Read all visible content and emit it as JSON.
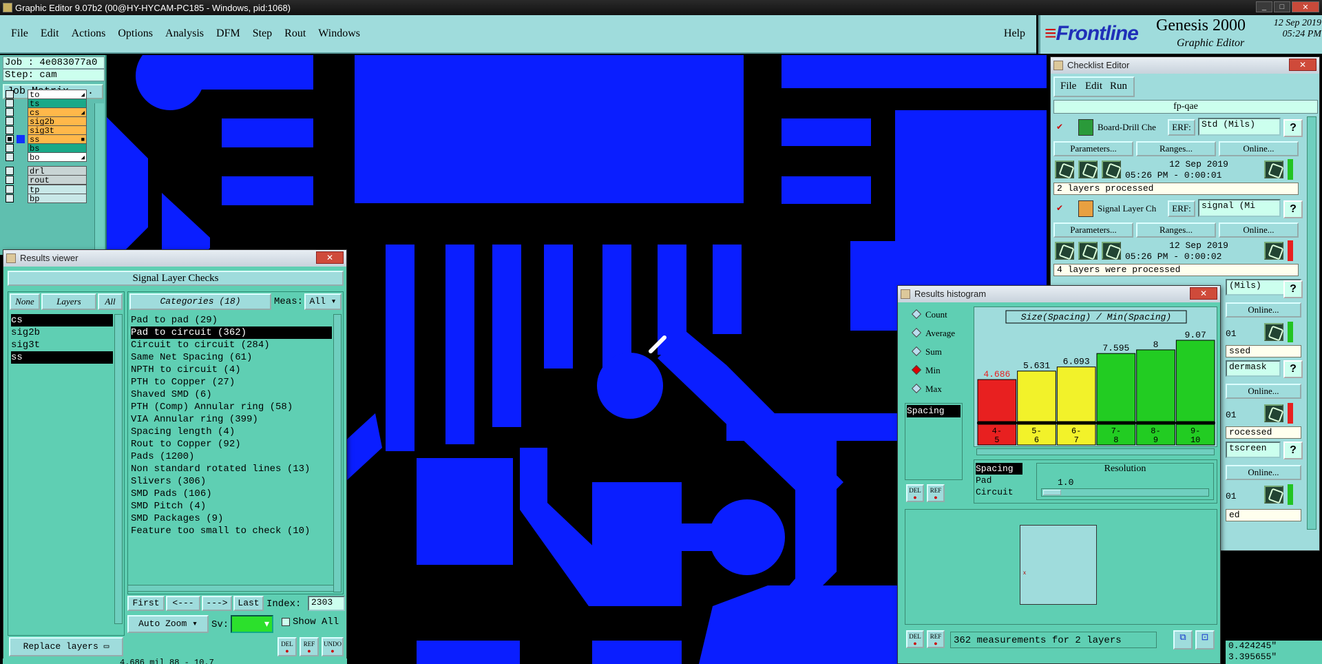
{
  "titlebar": {
    "text": "Graphic Editor 9.07b2 (00@HY-HYCAM-PC185 - Windows, pid:1068)"
  },
  "menu": [
    "File",
    "Edit",
    "Actions",
    "Options",
    "Analysis",
    "DFM",
    "Step",
    "Rout",
    "Windows"
  ],
  "help": "Help",
  "brand": {
    "logo": "Frontline",
    "product": "Genesis 2000",
    "sub": "Graphic Editor",
    "date": "12 Sep 2019",
    "time": "05:24 PM"
  },
  "job": {
    "job": "Job : 4e083077a0",
    "step": "Step: cam",
    "job_matrix": "Job Matrix ..."
  },
  "layers": [
    {
      "name": "to",
      "color": "#ffffff",
      "checked": false,
      "mark": "◢"
    },
    {
      "name": "ts",
      "color": "#1aa988",
      "checked": false,
      "mark": ""
    },
    {
      "name": "cs",
      "color": "#ffb84a",
      "checked": false,
      "mark": "◢"
    },
    {
      "name": "sig2b",
      "color": "#ffb84a",
      "checked": false,
      "mark": ""
    },
    {
      "name": "sig3t",
      "color": "#ffb84a",
      "checked": false,
      "mark": ""
    },
    {
      "name": "ss",
      "color": "#ffb84a",
      "checked": true,
      "mark": "■"
    },
    {
      "name": "bs",
      "color": "#1aa988",
      "checked": false,
      "mark": ""
    },
    {
      "name": "bo",
      "color": "#ffffff",
      "checked": false,
      "mark": "◢"
    },
    {
      "name": "drl",
      "color": "#c8d4d4",
      "checked": false,
      "mark": ""
    },
    {
      "name": "rout",
      "color": "#c8d4d4",
      "checked": false,
      "mark": ""
    },
    {
      "name": "tp",
      "color": "#c8e8e8",
      "checked": false,
      "mark": ""
    },
    {
      "name": "bp",
      "color": "#c8e8e8",
      "checked": false,
      "mark": ""
    }
  ],
  "results_viewer": {
    "title": "Results viewer",
    "header": "Signal Layer Checks",
    "none": "None",
    "layers": "Layers",
    "all": "All",
    "categories_label": "Categories (18)",
    "meas_label": "Meas:",
    "meas_value": "All",
    "layer_list": [
      "cs",
      "sig2b",
      "sig3t",
      "ss"
    ],
    "categories": [
      "Pad to pad (29)",
      "Pad to circuit (362)",
      "Circuit to circuit (284)",
      "Same Net Spacing (61)",
      "NPTH to circuit (4)",
      "PTH to Copper (27)",
      "Shaved SMD (6)",
      "PTH (Comp) Annular ring (58)",
      "VIA Annular ring (399)",
      "Spacing length (4)",
      "Rout to Copper (92)",
      "Pads (1200)",
      "Non standard rotated lines (13)",
      "Slivers (306)",
      "SMD Pads (106)",
      "SMD Pitch (4)",
      "SMD Packages (9)",
      "Feature too small to check (10)"
    ],
    "first": "First",
    "prev": "<---",
    "next": "--->",
    "last": "Last",
    "index_label": "Index:",
    "index_value": "2303",
    "auto_zoom": "Auto Zoom",
    "sv": "Sv:",
    "show_all": "Show All",
    "replace_layers": "Replace layers",
    "del": "DEL",
    "ref": "REF",
    "undo": "UNDO"
  },
  "checklist": {
    "title": "Checklist Editor",
    "menu": [
      "File",
      "Edit",
      "Run"
    ],
    "name": "fp-qae",
    "items": [
      {
        "name": "Board-Drill Che",
        "erf": "Std (Mils)",
        "date": "12 Sep 2019",
        "time": "05:26 PM - 0:00:01",
        "msg": "2 layers processed",
        "status": "#22c422"
      },
      {
        "name": "Signal Layer Ch",
        "erf": "signal (Mi",
        "date": "12 Sep 2019",
        "time": "05:26 PM - 0:00:02",
        "msg": "4 layers were processed",
        "status": "#e82020"
      }
    ],
    "erf": "ERF:",
    "params": "Parameters...",
    "ranges": "Ranges...",
    "online": "Online...",
    "partial": [
      "(Mils)",
      "Online...",
      "01",
      "ssed",
      "dermask",
      "Online...",
      "01",
      "rocessed",
      "tscreen",
      "Online...",
      "01",
      "ed"
    ]
  },
  "histogram": {
    "title": "Results histogram",
    "radios": [
      "Count",
      "Average",
      "Sum",
      "Min",
      "Max"
    ],
    "selected": "Min",
    "measure_list": [
      "Spacing"
    ],
    "chart_title": "Size(Spacing) / Min(Spacing)",
    "buckets": [
      "4-5",
      "5-6",
      "6-7",
      "7-8",
      "8-9",
      "9-10"
    ],
    "bucket_colors": [
      "#e82020",
      "#f2f22a",
      "#f2f22a",
      "#22cc22",
      "#22cc22",
      "#22cc22"
    ],
    "sub_list": [
      "Spacing",
      "Pad",
      "Circuit"
    ],
    "resolution_label": "Resolution",
    "resolution_value": "1.0",
    "footer": "362 measurements for 2 layers",
    "del": "DEL",
    "ref": "REF"
  },
  "chart_data": {
    "type": "bar",
    "title": "Size(Spacing) / Min(Spacing)",
    "categories": [
      "4-5",
      "5-6",
      "6-7",
      "7-8",
      "8-9",
      "9-10"
    ],
    "values": [
      4.686,
      5.631,
      6.093,
      7.595,
      8,
      9.07
    ],
    "value_labels": [
      "4.686",
      "5.631",
      "6.093",
      "7.595",
      "8",
      "9.07"
    ],
    "ylim": [
      0,
      9.07
    ]
  },
  "coords": {
    "x": "0.424245\"",
    "y": "3.395655\""
  },
  "status_bar": "4.686 mil   88 - 10.7"
}
